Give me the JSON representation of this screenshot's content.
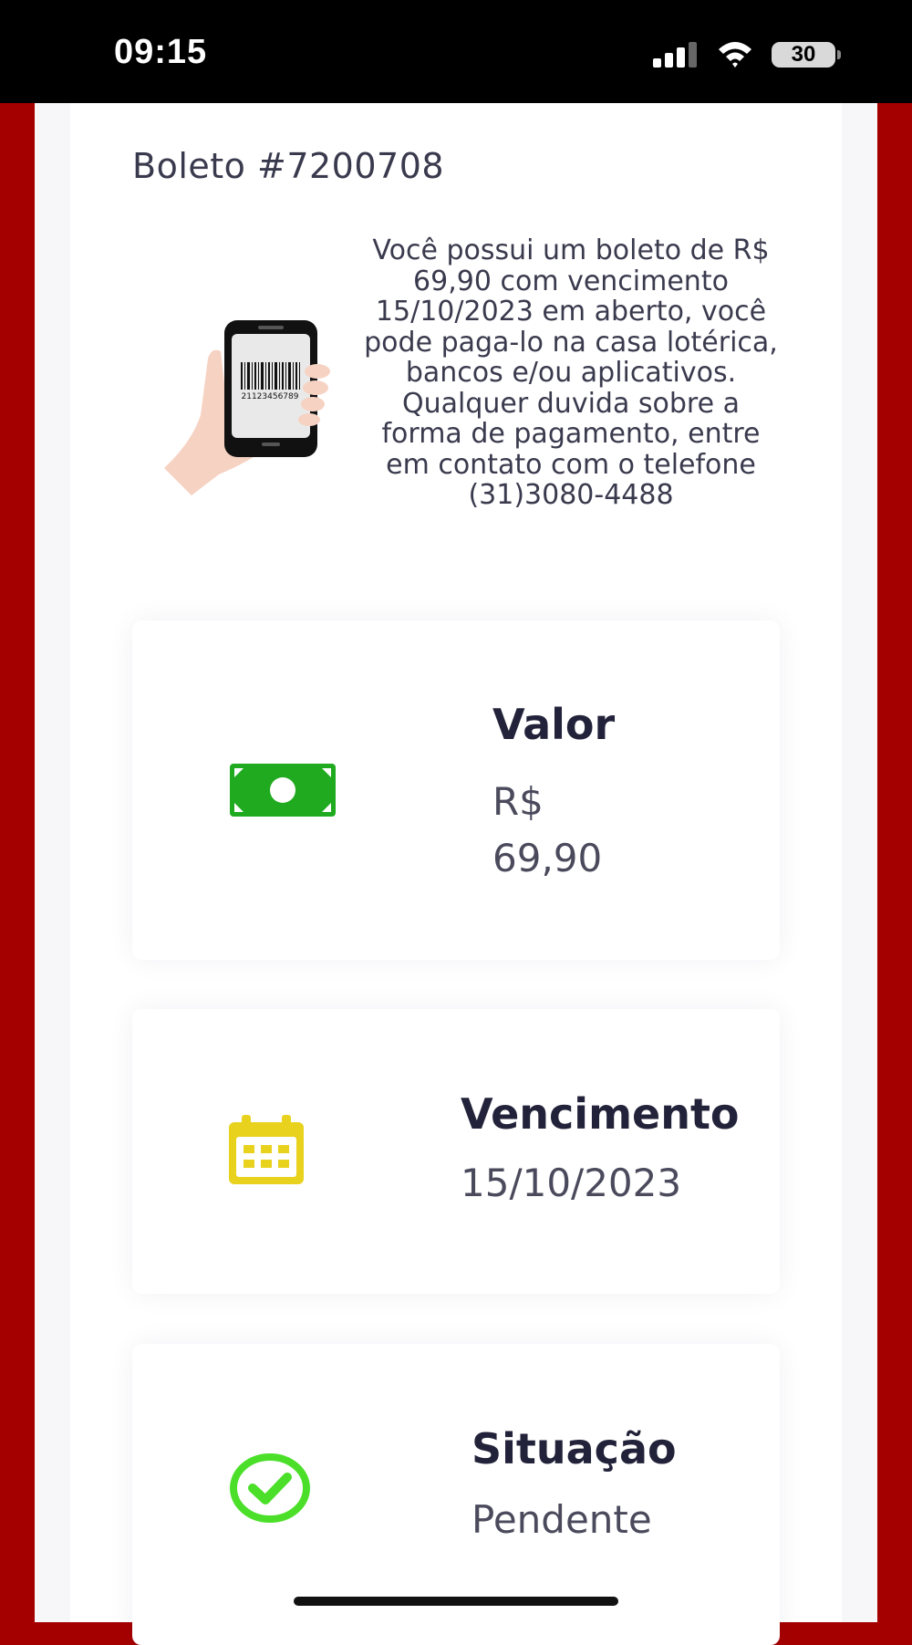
{
  "status_bar": {
    "time": "09:15",
    "battery": "30",
    "icons": [
      "signal-icon",
      "wifi-icon",
      "battery-icon"
    ]
  },
  "boleto": {
    "title": "Boleto #7200708",
    "info_text": "Você possui um boleto de R$ 69,90 com vencimento 15/10/2023 em aberto, você pode paga-lo na casa lotérica, bancos e/ou aplicativos. Qualquer duvida sobre a forma de pagamento, entre em contato com o telefone (31)3080-4488",
    "illustration_barcode_number": "21123456789"
  },
  "cards": {
    "valor": {
      "label": "Valor",
      "currency": "R$",
      "amount": "69,90",
      "icon": "money-bill-icon",
      "icon_color": "#1faa1f"
    },
    "vencimento": {
      "label": "Vencimento",
      "value": "15/10/2023",
      "icon": "calendar-icon",
      "icon_color": "#e8d21e"
    },
    "situacao": {
      "label": "Situação",
      "value": "Pendente",
      "icon": "check-circle-icon",
      "icon_color": "#4cdf2a"
    }
  },
  "colors": {
    "frame_red": "#a50000",
    "text_dark": "#22223a",
    "text_muted": "#4a4a5c"
  }
}
